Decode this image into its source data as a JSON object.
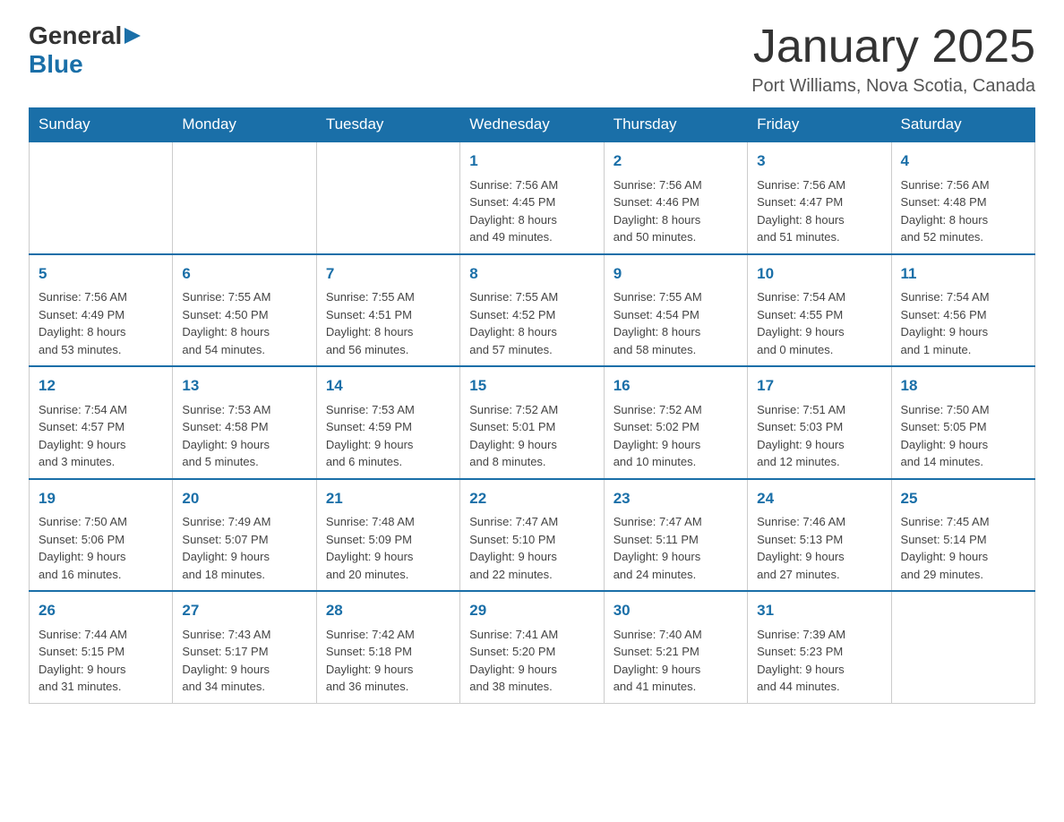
{
  "header": {
    "logo": {
      "general": "General",
      "arrow": "▶",
      "blue": "Blue"
    },
    "title": "January 2025",
    "location": "Port Williams, Nova Scotia, Canada"
  },
  "days_of_week": [
    "Sunday",
    "Monday",
    "Tuesday",
    "Wednesday",
    "Thursday",
    "Friday",
    "Saturday"
  ],
  "weeks": [
    [
      {
        "day": "",
        "info": ""
      },
      {
        "day": "",
        "info": ""
      },
      {
        "day": "",
        "info": ""
      },
      {
        "day": "1",
        "info": "Sunrise: 7:56 AM\nSunset: 4:45 PM\nDaylight: 8 hours\nand 49 minutes."
      },
      {
        "day": "2",
        "info": "Sunrise: 7:56 AM\nSunset: 4:46 PM\nDaylight: 8 hours\nand 50 minutes."
      },
      {
        "day": "3",
        "info": "Sunrise: 7:56 AM\nSunset: 4:47 PM\nDaylight: 8 hours\nand 51 minutes."
      },
      {
        "day": "4",
        "info": "Sunrise: 7:56 AM\nSunset: 4:48 PM\nDaylight: 8 hours\nand 52 minutes."
      }
    ],
    [
      {
        "day": "5",
        "info": "Sunrise: 7:56 AM\nSunset: 4:49 PM\nDaylight: 8 hours\nand 53 minutes."
      },
      {
        "day": "6",
        "info": "Sunrise: 7:55 AM\nSunset: 4:50 PM\nDaylight: 8 hours\nand 54 minutes."
      },
      {
        "day": "7",
        "info": "Sunrise: 7:55 AM\nSunset: 4:51 PM\nDaylight: 8 hours\nand 56 minutes."
      },
      {
        "day": "8",
        "info": "Sunrise: 7:55 AM\nSunset: 4:52 PM\nDaylight: 8 hours\nand 57 minutes."
      },
      {
        "day": "9",
        "info": "Sunrise: 7:55 AM\nSunset: 4:54 PM\nDaylight: 8 hours\nand 58 minutes."
      },
      {
        "day": "10",
        "info": "Sunrise: 7:54 AM\nSunset: 4:55 PM\nDaylight: 9 hours\nand 0 minutes."
      },
      {
        "day": "11",
        "info": "Sunrise: 7:54 AM\nSunset: 4:56 PM\nDaylight: 9 hours\nand 1 minute."
      }
    ],
    [
      {
        "day": "12",
        "info": "Sunrise: 7:54 AM\nSunset: 4:57 PM\nDaylight: 9 hours\nand 3 minutes."
      },
      {
        "day": "13",
        "info": "Sunrise: 7:53 AM\nSunset: 4:58 PM\nDaylight: 9 hours\nand 5 minutes."
      },
      {
        "day": "14",
        "info": "Sunrise: 7:53 AM\nSunset: 4:59 PM\nDaylight: 9 hours\nand 6 minutes."
      },
      {
        "day": "15",
        "info": "Sunrise: 7:52 AM\nSunset: 5:01 PM\nDaylight: 9 hours\nand 8 minutes."
      },
      {
        "day": "16",
        "info": "Sunrise: 7:52 AM\nSunset: 5:02 PM\nDaylight: 9 hours\nand 10 minutes."
      },
      {
        "day": "17",
        "info": "Sunrise: 7:51 AM\nSunset: 5:03 PM\nDaylight: 9 hours\nand 12 minutes."
      },
      {
        "day": "18",
        "info": "Sunrise: 7:50 AM\nSunset: 5:05 PM\nDaylight: 9 hours\nand 14 minutes."
      }
    ],
    [
      {
        "day": "19",
        "info": "Sunrise: 7:50 AM\nSunset: 5:06 PM\nDaylight: 9 hours\nand 16 minutes."
      },
      {
        "day": "20",
        "info": "Sunrise: 7:49 AM\nSunset: 5:07 PM\nDaylight: 9 hours\nand 18 minutes."
      },
      {
        "day": "21",
        "info": "Sunrise: 7:48 AM\nSunset: 5:09 PM\nDaylight: 9 hours\nand 20 minutes."
      },
      {
        "day": "22",
        "info": "Sunrise: 7:47 AM\nSunset: 5:10 PM\nDaylight: 9 hours\nand 22 minutes."
      },
      {
        "day": "23",
        "info": "Sunrise: 7:47 AM\nSunset: 5:11 PM\nDaylight: 9 hours\nand 24 minutes."
      },
      {
        "day": "24",
        "info": "Sunrise: 7:46 AM\nSunset: 5:13 PM\nDaylight: 9 hours\nand 27 minutes."
      },
      {
        "day": "25",
        "info": "Sunrise: 7:45 AM\nSunset: 5:14 PM\nDaylight: 9 hours\nand 29 minutes."
      }
    ],
    [
      {
        "day": "26",
        "info": "Sunrise: 7:44 AM\nSunset: 5:15 PM\nDaylight: 9 hours\nand 31 minutes."
      },
      {
        "day": "27",
        "info": "Sunrise: 7:43 AM\nSunset: 5:17 PM\nDaylight: 9 hours\nand 34 minutes."
      },
      {
        "day": "28",
        "info": "Sunrise: 7:42 AM\nSunset: 5:18 PM\nDaylight: 9 hours\nand 36 minutes."
      },
      {
        "day": "29",
        "info": "Sunrise: 7:41 AM\nSunset: 5:20 PM\nDaylight: 9 hours\nand 38 minutes."
      },
      {
        "day": "30",
        "info": "Sunrise: 7:40 AM\nSunset: 5:21 PM\nDaylight: 9 hours\nand 41 minutes."
      },
      {
        "day": "31",
        "info": "Sunrise: 7:39 AM\nSunset: 5:23 PM\nDaylight: 9 hours\nand 44 minutes."
      },
      {
        "day": "",
        "info": ""
      }
    ]
  ]
}
